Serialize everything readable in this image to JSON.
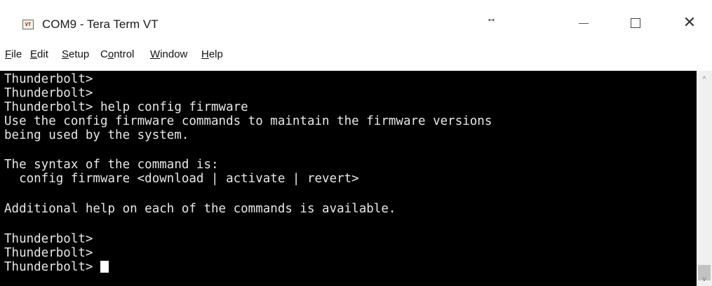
{
  "window": {
    "icon_text": "VT",
    "title": "COM9 - Tera Term VT",
    "resize_glyph": "↔",
    "close_glyph": "✕"
  },
  "menu": [
    {
      "underline": "F",
      "rest": "ile"
    },
    {
      "underline": "E",
      "rest": "dit"
    },
    {
      "underline": "S",
      "rest": "etup"
    },
    {
      "pre": "C",
      "underline": "o",
      "rest": "ntrol"
    },
    {
      "underline": "W",
      "rest": "indow"
    },
    {
      "underline": "H",
      "rest": "elp"
    }
  ],
  "terminal": {
    "lines": [
      "Thunderbolt>",
      "Thunderbolt>",
      "Thunderbolt> help config firmware",
      "Use the config firmware commands to maintain the firmware versions",
      "being used by the system.",
      "",
      "The syntax of the command is:",
      "  config firmware <download | activate | revert>",
      "",
      "Additional help on each of the commands is available.",
      "",
      "Thunderbolt>",
      "Thunderbolt>",
      "Thunderbolt> "
    ]
  },
  "scrollbar": {
    "up_glyph": "^",
    "down_glyph": "v"
  },
  "colors": {
    "terminal_bg": "#000000",
    "terminal_fg": "#e8e8e8"
  }
}
